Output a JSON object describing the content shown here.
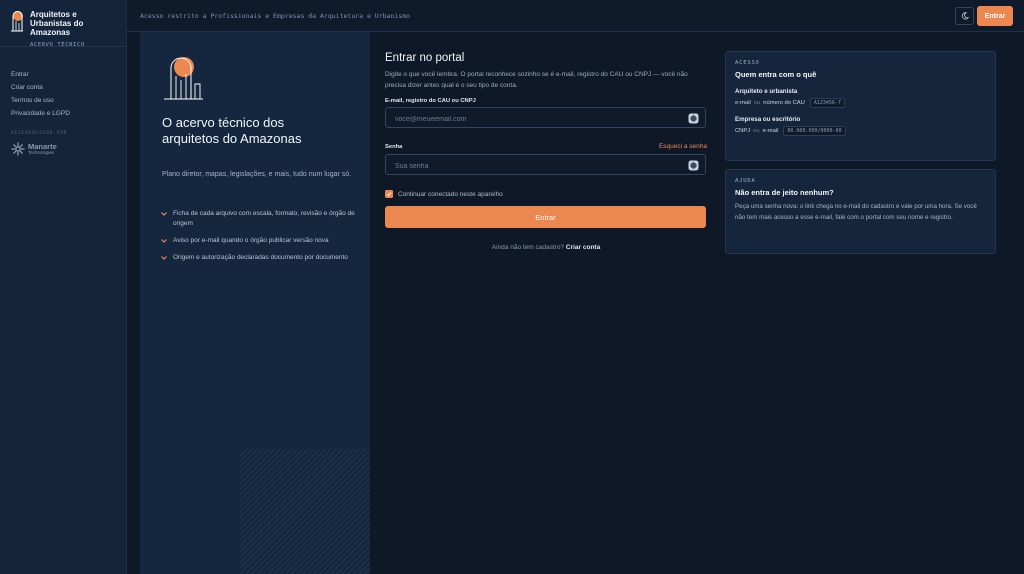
{
  "brand": {
    "title": "Arquitetos e Urbanistas do Amazonas",
    "subtitle": "ACERVO TÉCNICO"
  },
  "nav": {
    "items": [
      {
        "label": "Entrar"
      },
      {
        "label": "Criar conta"
      },
      {
        "label": "Termos de uso"
      },
      {
        "label": "Privacidade e LGPD"
      }
    ]
  },
  "developer": {
    "label": "DESENVOLVIDO POR",
    "name": "Manarte",
    "sub": "Technologies"
  },
  "topbar": {
    "notice": "Acesso restrito a Profissionais e Empresas da Arquitetura e Urbanismo",
    "theme_icon": "moon-icon",
    "login_label": "Entrar"
  },
  "hero": {
    "title": "O acervo técnico dos arquitetos do Amazonas",
    "description": "Plano diretor, mapas, legislações, e mais, tudo num lugar só.",
    "features": [
      {
        "text": "Ficha de cada arquivo com escala, formato, revisão e órgão de origem"
      },
      {
        "text": "Aviso por e-mail quando o órgão publicar versão nova"
      },
      {
        "text": "Origem e autorização declaradas documento por documento"
      }
    ]
  },
  "form": {
    "title": "Entrar no portal",
    "intro": "Digite o que você lembra. O portal reconhece sozinho se é e-mail, registro do CAU ou CNPJ — você não precisa dizer antes qual é o seu tipo de conta.",
    "identifier_label": "E-mail, registro do CAU ou CNPJ",
    "identifier_placeholder": "voce@meueemail.com",
    "password_label": "Senha",
    "forgot_label": "Esqueci a senha",
    "password_placeholder": "Sua senha",
    "remember_label": "Continuar conectado neste aparelho",
    "remember_checked": true,
    "submit_label": "Entrar",
    "signup_prompt": "Ainda não tem cadastro?",
    "signup_link": "Criar conta"
  },
  "access_card": {
    "eyebrow": "ACESSO",
    "title": "Quem entra com o quê",
    "roles": [
      {
        "title": "Arquiteto e urbanista",
        "line1": "e-mail",
        "ou": "ou",
        "line2": "número do CAU",
        "example": "A123456-7"
      },
      {
        "title": "Empresa ou escritório",
        "line1": "CNPJ",
        "ou": "ou",
        "line2": "e-mail",
        "example": "00.000.000/0000-00"
      }
    ]
  },
  "help_card": {
    "eyebrow": "AJUDA",
    "title": "Não entra de jeito nenhum?",
    "text": "Peça uma senha nova: o link chega no e-mail do cadastro e vale por uma hora. Se você não tem mais acesso a esse e-mail, fale com o portal com seu nome e registro."
  },
  "colors": {
    "accent": "#ec8750",
    "background": "#0e1826",
    "sidebar": "#14243a",
    "panel": "#15273e"
  }
}
